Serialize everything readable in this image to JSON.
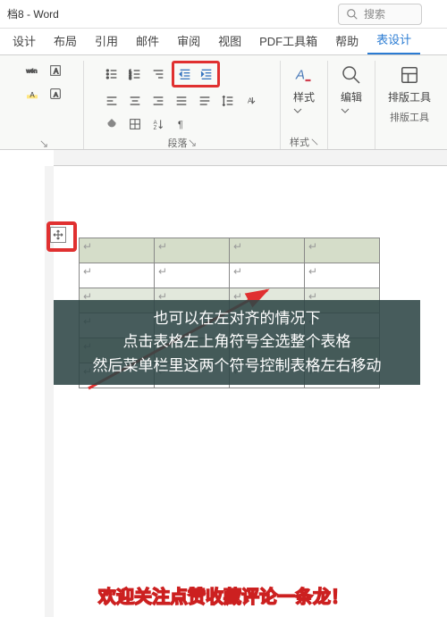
{
  "title": "档8 - Word",
  "search_placeholder": "搜索",
  "tabs": [
    "设计",
    "布局",
    "引用",
    "邮件",
    "审阅",
    "视图",
    "PDF工具箱",
    "帮助",
    "表设计"
  ],
  "active_tab_index": 8,
  "ribbon": {
    "paragraph_label": "段落",
    "styles_btn": "样式",
    "styles_label": "样式",
    "edit_btn": "编辑",
    "layout_btn": "排版工具",
    "layout_label": "排版工具"
  },
  "overlay": {
    "line1": "也可以在左对齐的情况下",
    "line2": "点击表格左上角符号全选整个表格",
    "line3": "然后菜单栏里这两个符号控制表格左右移动"
  },
  "table": {
    "rows": 6,
    "cols": 4,
    "cell_mark": "↵"
  },
  "footer_text": "欢迎关注点赞收藏评论一条龙！"
}
